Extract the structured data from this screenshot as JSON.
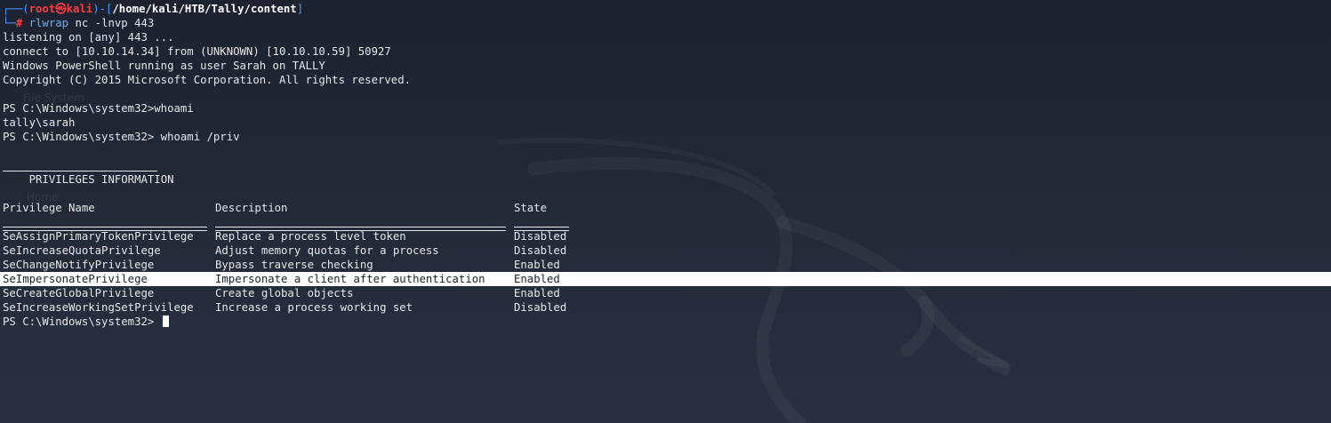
{
  "terminal": {
    "prompt": {
      "corner_top": "┌──(",
      "user": "root",
      "skull": "㉿",
      "host": "kali",
      "sep": ")-[",
      "path": "/home/kali/HTB/Tally/content",
      "close": "]",
      "corner_bottom": "└─",
      "hash": "#",
      "cmd_name": "rlwrap",
      "cmd_args": "nc -lnvp 443"
    },
    "lines": {
      "listening": "listening on [any] 443 ...",
      "connect": "connect to [10.10.14.34] from (UNKNOWN) [10.10.10.59] 50927",
      "ps_banner": "Windows PowerShell running as user Sarah on TALLY",
      "copyright": "Copyright (C) 2015 Microsoft Corporation. All rights reserved.",
      "cmd_whoami": "PS C:\\Windows\\system32>whoami",
      "whoami_out": "tally\\sarah",
      "cmd_priv": "PS C:\\Windows\\system32> whoami /priv",
      "priv_header": "PRIVILEGES INFORMATION",
      "final_prompt": "PS C:\\Windows\\system32> "
    },
    "table": {
      "headers": {
        "name": "Privilege Name",
        "description": "Description",
        "state": "State"
      },
      "rows": [
        {
          "name": "SeAssignPrimaryTokenPrivilege",
          "description": "Replace a process level token",
          "state": "Disabled"
        },
        {
          "name": "SeIncreaseQuotaPrivilege",
          "description": "Adjust memory quotas for a process",
          "state": "Disabled"
        },
        {
          "name": "SeChangeNotifyPrivilege",
          "description": "Bypass traverse checking",
          "state": "Enabled"
        },
        {
          "name": "SeImpersonatePrivilege",
          "description": "Impersonate a client after authentication",
          "state": "Enabled"
        },
        {
          "name": "SeCreateGlobalPrivilege",
          "description": "Create global objects",
          "state": "Enabled"
        },
        {
          "name": "SeIncreaseWorkingSetPrivilege",
          "description": "Increase a process working set",
          "state": "Disabled"
        }
      ],
      "highlighted_row": 3
    },
    "colors": {
      "background": "#1f2430",
      "text": "#e6e7ea",
      "prompt_blue": "#4c9aff",
      "root_red": "#ff3b3b",
      "highlight": "#ffffff"
    }
  },
  "desktop_ghost": {
    "file_system": "File System",
    "home": "Home"
  }
}
